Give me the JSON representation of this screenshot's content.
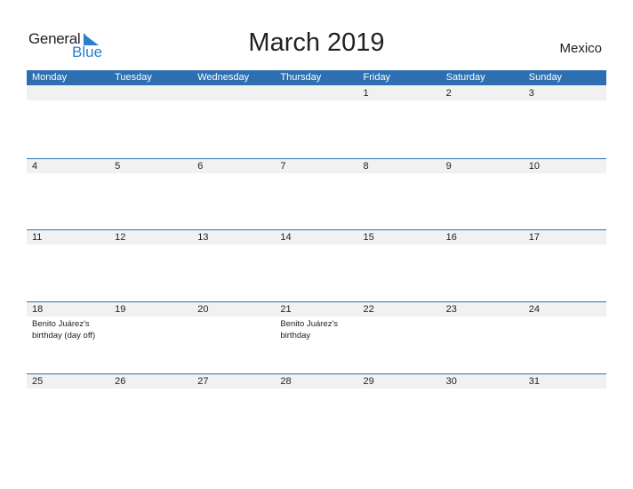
{
  "logo": {
    "general": "General",
    "blue": "Blue"
  },
  "title": "March 2019",
  "country": "Mexico",
  "colors": {
    "accent": "#2e6fb1",
    "logo_blue": "#2a7fcf",
    "date_strip": "#f1f1f1"
  },
  "weekdays": [
    "Monday",
    "Tuesday",
    "Wednesday",
    "Thursday",
    "Friday",
    "Saturday",
    "Sunday"
  ],
  "weeks": [
    {
      "days": [
        "",
        "",
        "",
        "",
        "1",
        "2",
        "3"
      ],
      "events": [
        "",
        "",
        "",
        "",
        "",
        "",
        ""
      ]
    },
    {
      "days": [
        "4",
        "5",
        "6",
        "7",
        "8",
        "9",
        "10"
      ],
      "events": [
        "",
        "",
        "",
        "",
        "",
        "",
        ""
      ]
    },
    {
      "days": [
        "11",
        "12",
        "13",
        "14",
        "15",
        "16",
        "17"
      ],
      "events": [
        "",
        "",
        "",
        "",
        "",
        "",
        ""
      ]
    },
    {
      "days": [
        "18",
        "19",
        "20",
        "21",
        "22",
        "23",
        "24"
      ],
      "events": [
        "Benito Juárez's birthday (day off)",
        "",
        "",
        "Benito Juárez's birthday",
        "",
        "",
        ""
      ]
    },
    {
      "days": [
        "25",
        "26",
        "27",
        "28",
        "29",
        "30",
        "31"
      ],
      "events": [
        "",
        "",
        "",
        "",
        "",
        "",
        ""
      ]
    }
  ]
}
